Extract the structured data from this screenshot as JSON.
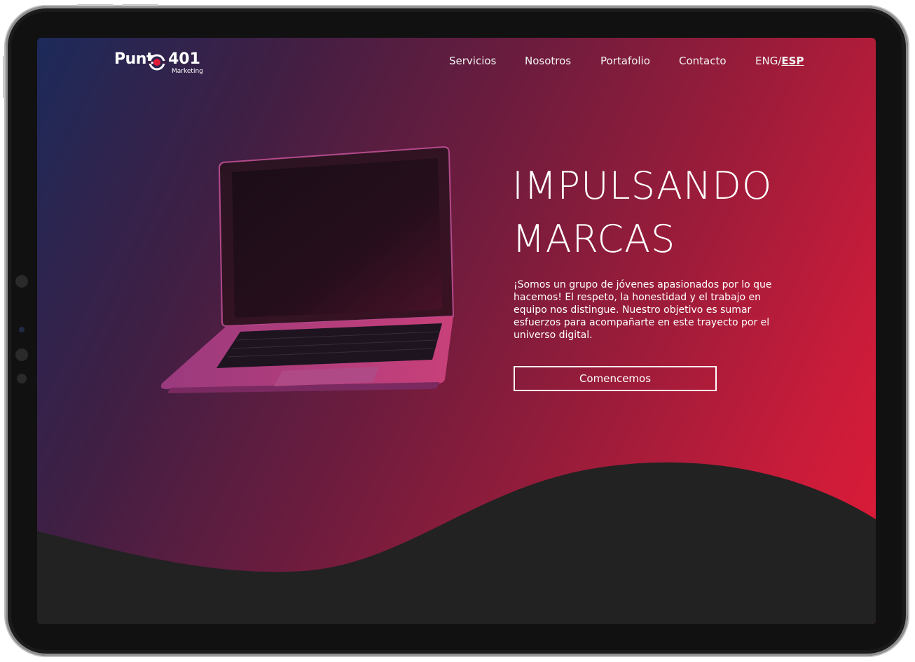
{
  "brand": {
    "name": "Punt",
    "number": "401",
    "subtitle": "Marketing",
    "accent": "#e01a37"
  },
  "nav": {
    "items": [
      "Servicios",
      "Nosotros",
      "Portafolio",
      "Contacto"
    ],
    "lang_inactive": "ENG/",
    "lang_active": "ESP"
  },
  "hero": {
    "title": "IMPULSANDO\nMARCAS",
    "body": "¡Somos un grupo de jóvenes apasionados por lo que hacemos! El respeto, la honestidad y el trabajo en equipo nos distingue. Nuestro objetivo es sumar esfuerzos para acompañarte en este trayecto por el universo digital.",
    "cta_label": "Comencemos"
  },
  "colors": {
    "gradient_start": "#1c2a5a",
    "gradient_end": "#e01a37",
    "wave": "#222222",
    "frame": "#1b1b1b"
  },
  "icons": {
    "logo_mark": "target-icon",
    "laptop": "laptop-image"
  }
}
